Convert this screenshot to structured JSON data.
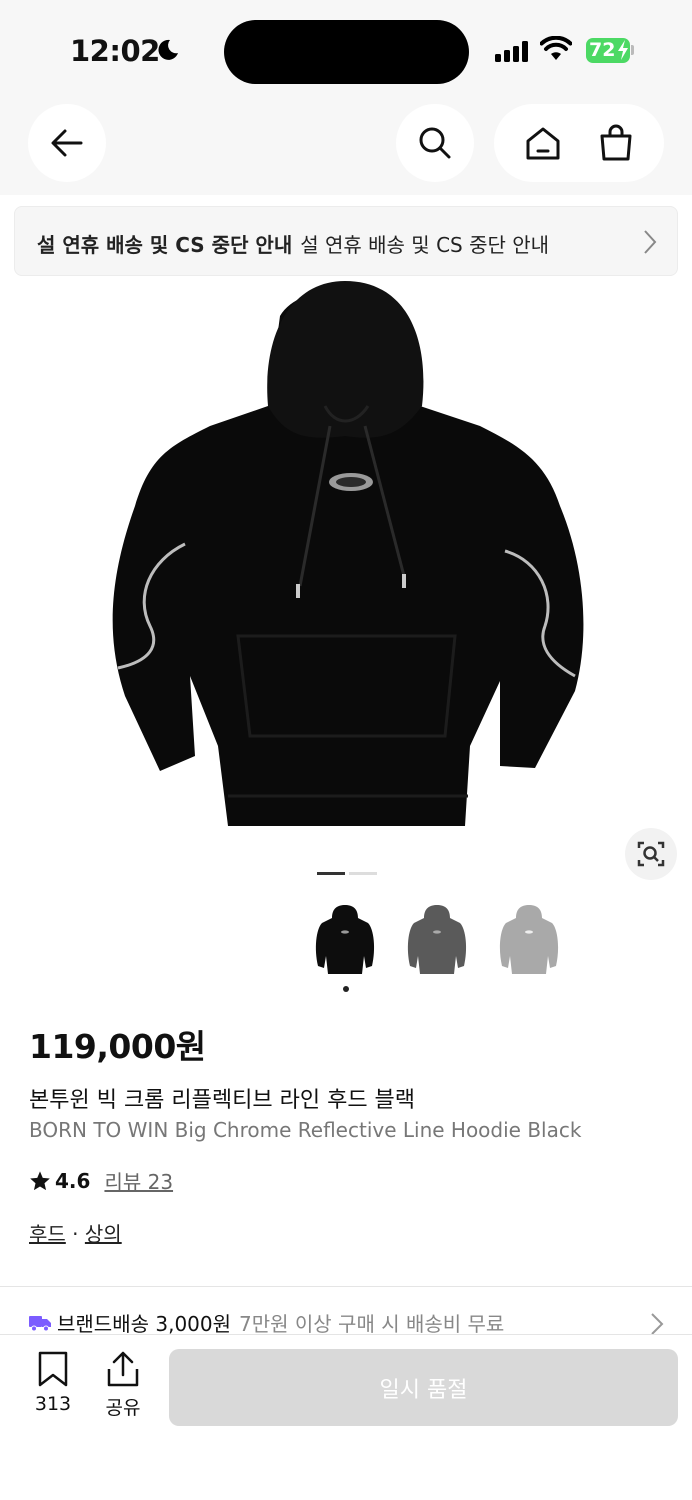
{
  "status_bar": {
    "time": "12:02",
    "battery": "72",
    "icons": [
      "moon-icon",
      "signal-icon",
      "wifi-icon",
      "battery-icon"
    ]
  },
  "nav": {
    "icons": [
      "back-arrow-icon",
      "search-icon",
      "home-icon",
      "shopping-bag-icon"
    ]
  },
  "notice": {
    "bold_text": "설  연휴 배송 및 CS 중단 안내",
    "repeat_text": "설  연휴 배송 및 CS 중단 안내"
  },
  "gallery": {
    "page_count": 2,
    "current_page": 1,
    "thumbnails": [
      {
        "color": "#0d0d0d",
        "label": "black"
      },
      {
        "color": "#5a5a5a",
        "label": "charcoal"
      },
      {
        "color": "#a9a9a9",
        "label": "grey"
      }
    ],
    "selected_thumbnail": 0
  },
  "product": {
    "price": "119,000원",
    "name_ko": "본투윈 빅 크롬 리플렉티브 라인 후드 블랙",
    "name_en": "BORN TO WIN Big Chrome Reflective Line Hoodie Black",
    "rating": "4.6",
    "review_label": "리뷰 23",
    "category_1": "후드",
    "category_separator": "·",
    "category_2": "상의"
  },
  "shipping": {
    "label": "브랜드배송 3,000원",
    "sub": "7만원 이상 구매 시 배송비 무료",
    "icon_color": "#7b5cff"
  },
  "bottom_bar": {
    "bookmark_count": "313",
    "share_label": "공유",
    "buy_button_label": "일시 품절"
  }
}
